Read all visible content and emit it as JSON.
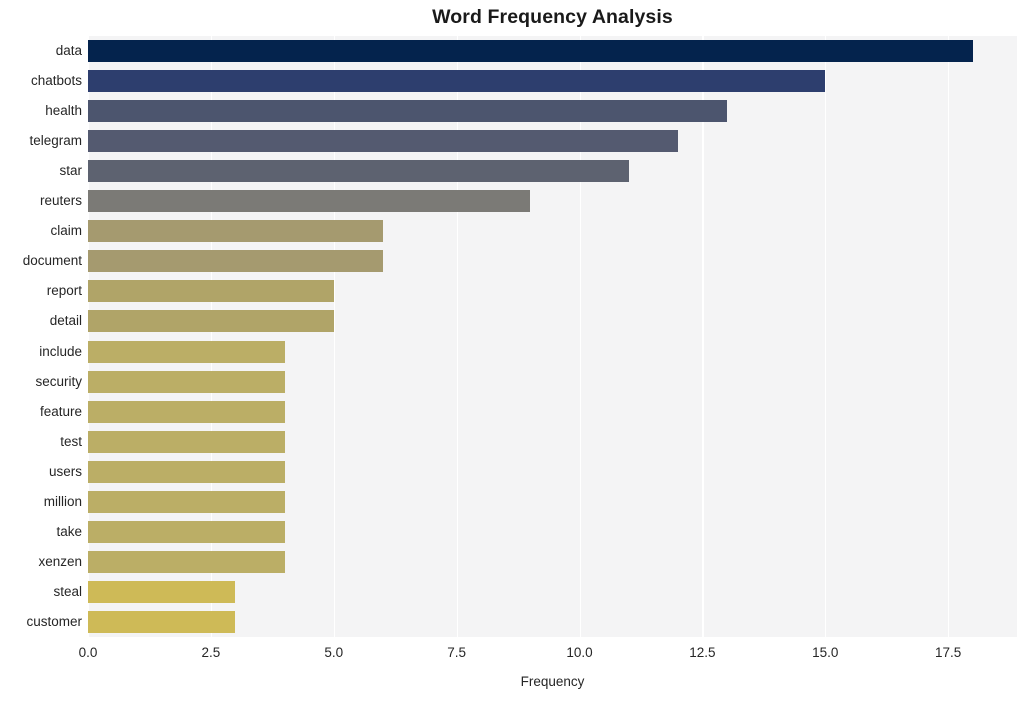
{
  "chart_data": {
    "type": "bar",
    "orientation": "horizontal",
    "title": "Word Frequency Analysis",
    "xlabel": "Frequency",
    "ylabel": "",
    "categories": [
      "data",
      "chatbots",
      "health",
      "telegram",
      "star",
      "reuters",
      "claim",
      "document",
      "report",
      "detail",
      "include",
      "security",
      "feature",
      "test",
      "users",
      "million",
      "take",
      "xenzen",
      "steal",
      "customer"
    ],
    "values": [
      18,
      15,
      13,
      12,
      11,
      9,
      6,
      6,
      5,
      5,
      4,
      4,
      4,
      4,
      4,
      4,
      4,
      4,
      3,
      3
    ],
    "bar_colors": [
      "#04234d",
      "#2d3e6e",
      "#4c556e",
      "#545a70",
      "#5d6270",
      "#7b7a76",
      "#a59a6f",
      "#a59a6f",
      "#b0a468",
      "#b0a468",
      "#bbae66",
      "#bbae66",
      "#bbae66",
      "#bbae66",
      "#bbae66",
      "#bbae66",
      "#bbae66",
      "#bbae66",
      "#ceba57",
      "#ceba57"
    ],
    "xlim": [
      0,
      18.9
    ],
    "xticks": [
      0.0,
      2.5,
      5.0,
      7.5,
      10.0,
      12.5,
      15.0,
      17.5
    ],
    "xtick_labels": [
      "0.0",
      "2.5",
      "5.0",
      "7.5",
      "10.0",
      "12.5",
      "15.0",
      "17.5"
    ],
    "grid": true,
    "grid_axis": "x",
    "grid_color": "#ffffff",
    "plot_background": "#f4f4f5",
    "figure_background": "#ffffff",
    "legend": null
  }
}
